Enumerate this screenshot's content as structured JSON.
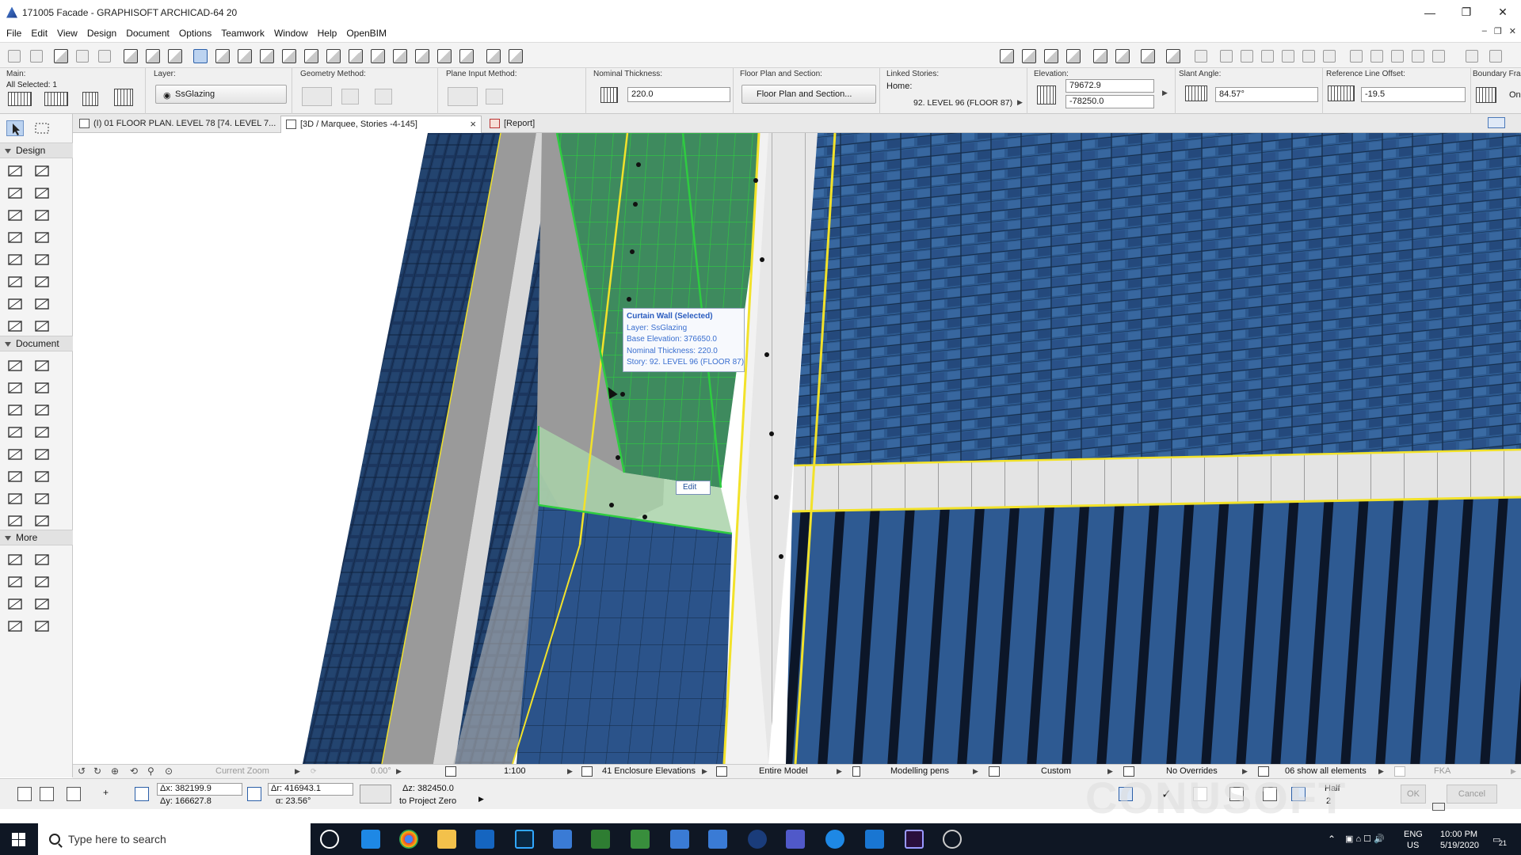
{
  "window": {
    "title": "171005 Facade - GRAPHISOFT ARCHICAD-64 20",
    "minimize": "—",
    "restore": "❐",
    "close": "✕"
  },
  "menu": {
    "items": [
      "File",
      "Edit",
      "View",
      "Design",
      "Document",
      "Options",
      "Teamwork",
      "Window",
      "Help",
      "OpenBIM"
    ]
  },
  "mdi": {
    "min": "–",
    "restore": "❐",
    "close": "✕"
  },
  "infobox": {
    "main": {
      "label": "Main:",
      "selected": "All Selected: 1"
    },
    "layer": {
      "label": "Layer:",
      "value": "SsGlazing"
    },
    "geometry": {
      "label": "Geometry Method:"
    },
    "plane": {
      "label": "Plane Input Method:"
    },
    "thickness": {
      "label": "Nominal Thickness:",
      "value": "220.0"
    },
    "floorplan": {
      "label": "Floor Plan and Section:",
      "value": "Floor Plan and Section..."
    },
    "linked": {
      "label": "Linked Stories:",
      "home_label": "Home:",
      "home_value": "92. LEVEL 96 (FLOOR 87)"
    },
    "elevation": {
      "label": "Elevation:",
      "value1": "79672.9",
      "value2": "-78250.0"
    },
    "slant": {
      "label": "Slant Angle:",
      "value": "84.57°"
    },
    "refline": {
      "label": "Reference Line Offset:",
      "value": "-19.5"
    },
    "boundary": {
      "label": "Boundary Fram",
      "value": "On"
    }
  },
  "toolbox": {
    "design": "Design",
    "document": "Document",
    "more": "More"
  },
  "tabs": [
    {
      "label": "(I) 01 FLOOR PLAN. LEVEL 78 [74. LEVEL 7..."
    },
    {
      "label": "[3D / Marquee, Stories -4-145]",
      "close": "×"
    },
    {
      "label": "[Report]"
    }
  ],
  "tooltip": {
    "title": "Curtain Wall (Selected)",
    "lines": [
      "Layer: SsGlazing",
      "Base Elevation: 376650.0",
      "Nominal Thickness: 220.0",
      "Story: 92. LEVEL 96 (FLOOR 87)"
    ]
  },
  "edit_button": "Edit",
  "navbar": {
    "zoom": "Current Zoom",
    "angle": "0.00°",
    "scale": "1:100",
    "layer_combo": "41 Enclosure Elevations",
    "model_view": "Entire Model",
    "pen_set": "Modelling pens",
    "dimension": "Custom",
    "overrides": "No Overrides",
    "renovation": "06 show all elements",
    "fka": "FKA"
  },
  "coords": {
    "dx": "Δx: 382199.9",
    "dy": "Δy: 166627.8",
    "dr": "Δr: 416943.1",
    "angle": "α: 23.56°",
    "dz": "Δz: 382450.0",
    "ref": "to Project Zero",
    "half": "Half",
    "two": "2",
    "ok": "OK",
    "cancel": "Cancel"
  },
  "watermark": "CONUSOFT",
  "taskbar": {
    "search_placeholder": "Type here to search",
    "lang1": "ENG",
    "lang2": "US",
    "time": "10:00 PM",
    "date": "5/19/2020",
    "notif": "21"
  },
  "colors": {
    "accent": "#2b5fa8",
    "facade_dark": "#1f3e6b",
    "facade_mid": "#2f5d93",
    "selection": "#3fae4a",
    "highlight": "#f2e22a"
  }
}
